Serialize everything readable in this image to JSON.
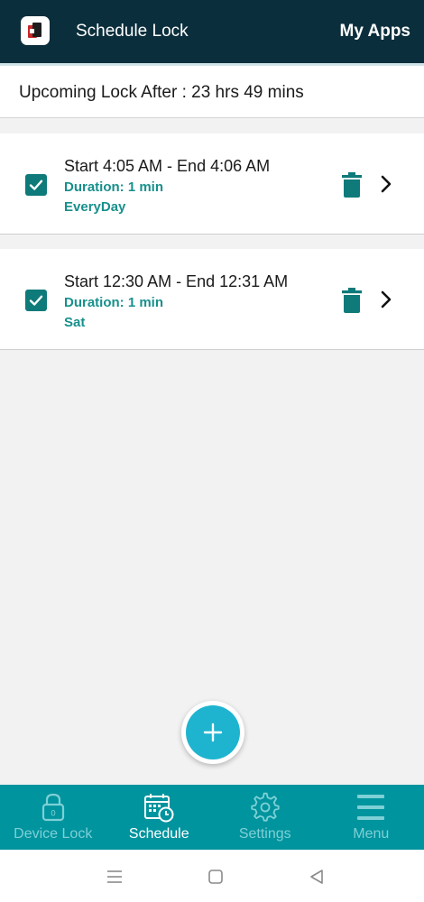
{
  "header": {
    "title": "Schedule Lock",
    "my_apps": "My Apps",
    "app_icon": "lock-app-icon"
  },
  "upcoming": {
    "text": "Upcoming Lock After : 23 hrs 49 mins"
  },
  "schedules": [
    {
      "time": "Start 4:05 AM - End 4:06 AM",
      "duration": "Duration: 1 min",
      "days": "EveryDay",
      "checked": true
    },
    {
      "time": "Start 12:30 AM - End 12:31 AM",
      "duration": "Duration: 1 min",
      "days": "Sat",
      "checked": true
    }
  ],
  "fab": {
    "icon": "plus-icon"
  },
  "nav": [
    {
      "label": "Device Lock",
      "icon": "padlock-icon",
      "active": false
    },
    {
      "label": "Schedule",
      "icon": "calendar-clock-icon",
      "active": true
    },
    {
      "label": "Settings",
      "icon": "gear-icon",
      "active": false
    },
    {
      "label": "Menu",
      "icon": "hamburger-icon",
      "active": false
    }
  ],
  "colors": {
    "header_bg": "#0b2e3c",
    "accent": "#17908c",
    "nav_bg": "#00949e",
    "fab": "#1eb4cf"
  }
}
